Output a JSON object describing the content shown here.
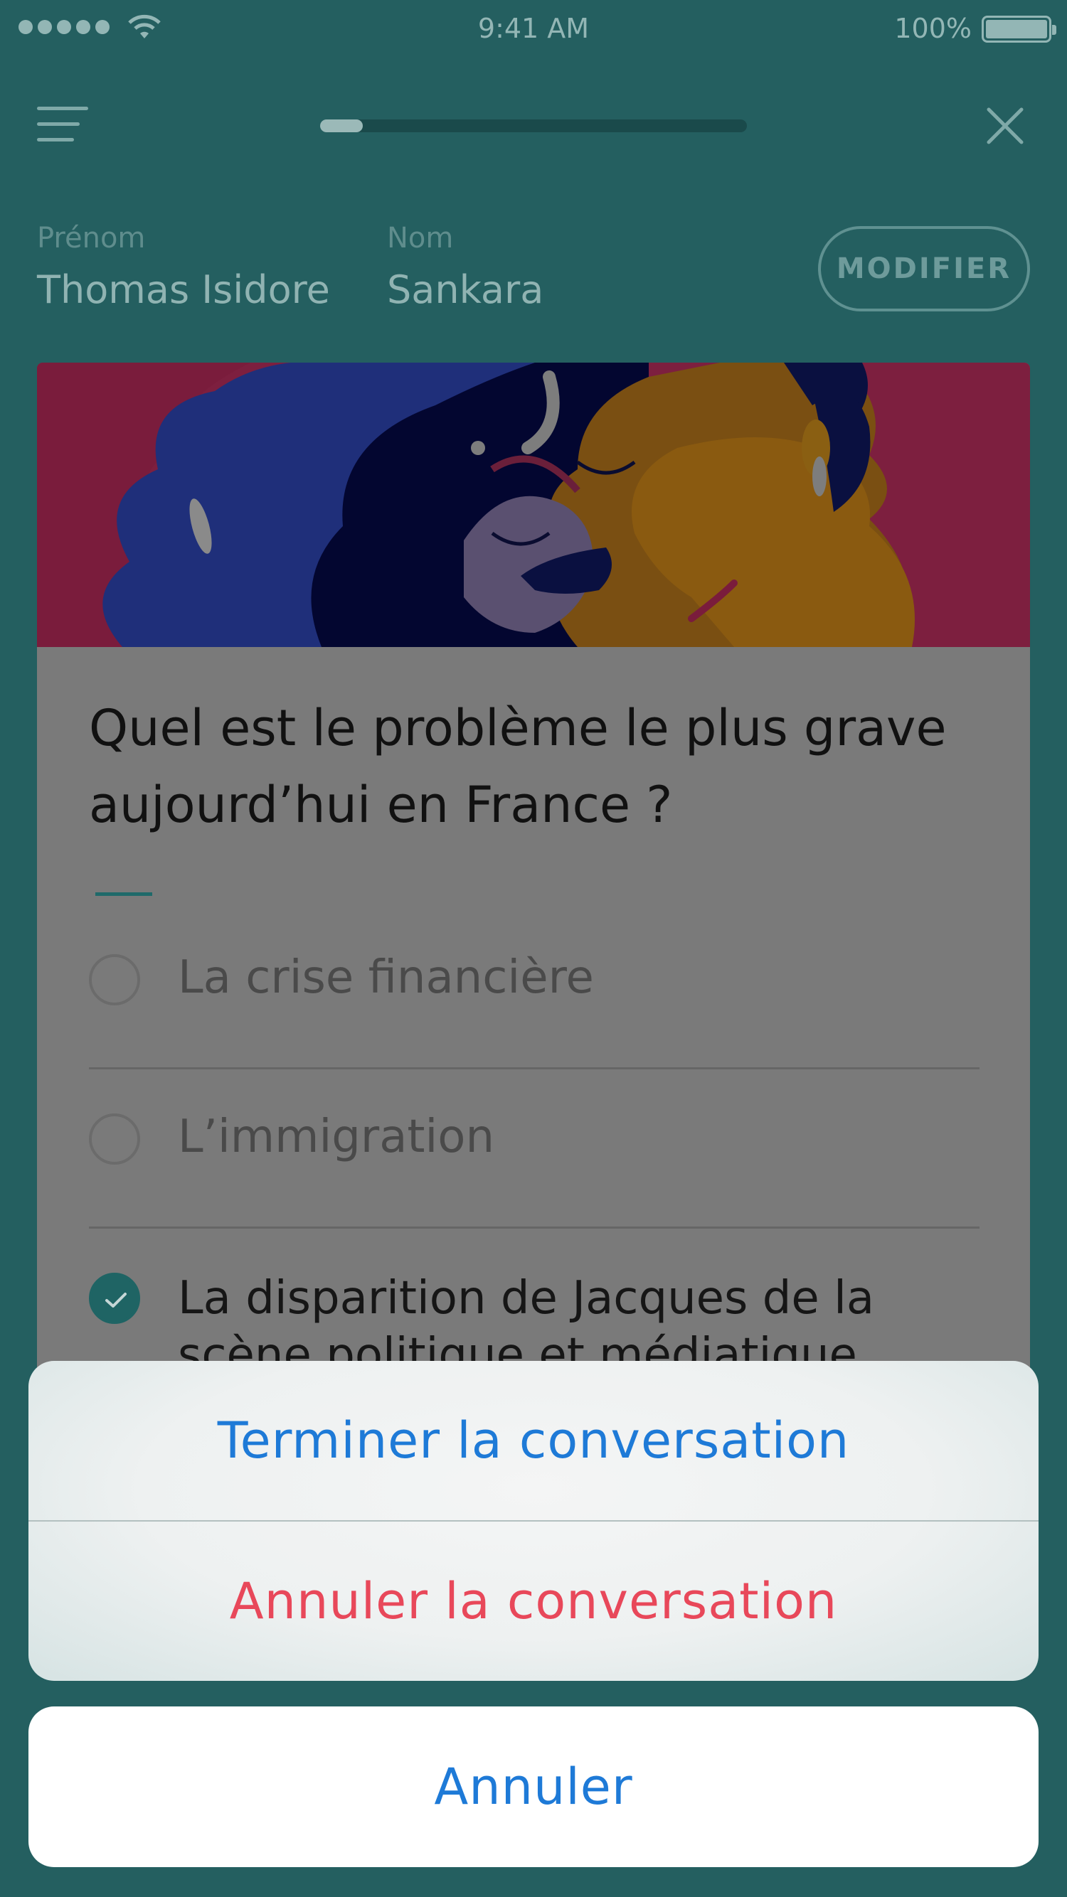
{
  "status_bar": {
    "time": "9:41 AM",
    "battery": "100%",
    "wifi_icon": "wifi-icon",
    "signal_icon": "signal-dots-icon",
    "battery_icon": "battery-icon"
  },
  "header": {
    "menu_icon": "menu-icon",
    "close_icon": "close-icon",
    "progress": 0.1
  },
  "profile": {
    "first_name_label": "Prénom",
    "first_name_value": "Thomas Isidore",
    "last_name_label": "Nom",
    "last_name_value": "Sankara",
    "modify_label": "MODIFIER"
  },
  "question": {
    "text": "Quel est le problème le plus grave aujourd’hui  en France ?",
    "options": [
      {
        "label": "La crise financière",
        "selected": false
      },
      {
        "label": "L’immigration",
        "selected": false
      },
      {
        "label": "La disparition de Jacques de la scène politique et médiatique",
        "selected": true
      }
    ]
  },
  "action_sheet": {
    "terminate_label": "Terminer la conversation",
    "cancel_conversation_label": "Annuler la conversation",
    "cancel_label": "Annuler"
  },
  "colors": {
    "background": "#245f60",
    "action_blue": "#1e7ad7",
    "destructive_red": "#e8485a"
  }
}
